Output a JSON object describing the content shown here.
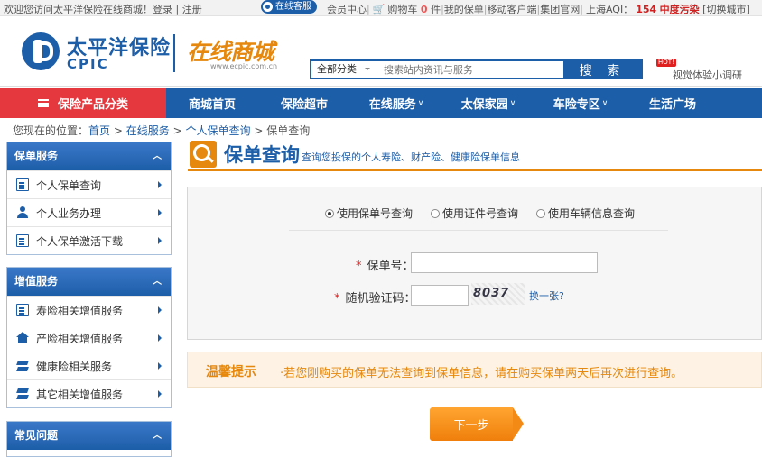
{
  "topbar": {
    "welcome": "欢迎您访问太平洋保险在线商城！",
    "login": "登录",
    "register": "注册",
    "service": "在线客服",
    "member": "会员中心",
    "cart": "购物车",
    "cart_count": "0",
    "cart_unit": "件",
    "my_policy": "我的保单",
    "mobile": "移动客户端",
    "group": "集团官网",
    "aqi_label": "上海AQI：",
    "aqi_value": "154",
    "aqi_status": "中度污染",
    "switch_city": "[切换城市]"
  },
  "logo": {
    "cn": "太平洋保险",
    "en": "CPIC"
  },
  "mall": {
    "title": "在线商城",
    "url": "www.ecpic.com.cn"
  },
  "search": {
    "category": "全部分类",
    "placeholder": "搜索站内资讯与服务",
    "button": "搜 索"
  },
  "hotlink": {
    "badge": "HOT!",
    "text": "视觉体验小调研"
  },
  "nav": {
    "category": "保险产品分类",
    "items": [
      "商城首页",
      "保险超市",
      "在线服务",
      "太保家园",
      "车险专区",
      "生活广场"
    ]
  },
  "breadcrumb": {
    "prefix": "您现在的位置：",
    "home": "首页",
    "level1": "在线服务",
    "level2": "个人保单查询",
    "current": "保单查询",
    "sep": ">"
  },
  "sidebar": {
    "policy": {
      "title": "保单服务",
      "items": [
        "个人保单查询",
        "个人业务办理",
        "个人保单激活下载"
      ]
    },
    "value": {
      "title": "增值服务",
      "items": [
        "寿险相关增值服务",
        "产险相关增值服务",
        "健康险相关服务",
        "其它相关增值服务"
      ]
    },
    "faq": {
      "title": "常见问题"
    }
  },
  "page": {
    "title": "保单查询",
    "subtitle": "查询您投保的个人寿险、财产险、健康险保单信息"
  },
  "form": {
    "modes": [
      "使用保单号查询",
      "使用证件号查询",
      "使用车辆信息查询"
    ],
    "policy_label": "保单号：",
    "captcha_label": "随机验证码：",
    "captcha_text": "8037",
    "change": "换一张?",
    "star": "*"
  },
  "tip": {
    "heading": "温馨提示",
    "body": "·若您刚购买的保单无法查询到保单信息，请在购买保单两天后再次进行查询。"
  },
  "next_button": "下一步"
}
